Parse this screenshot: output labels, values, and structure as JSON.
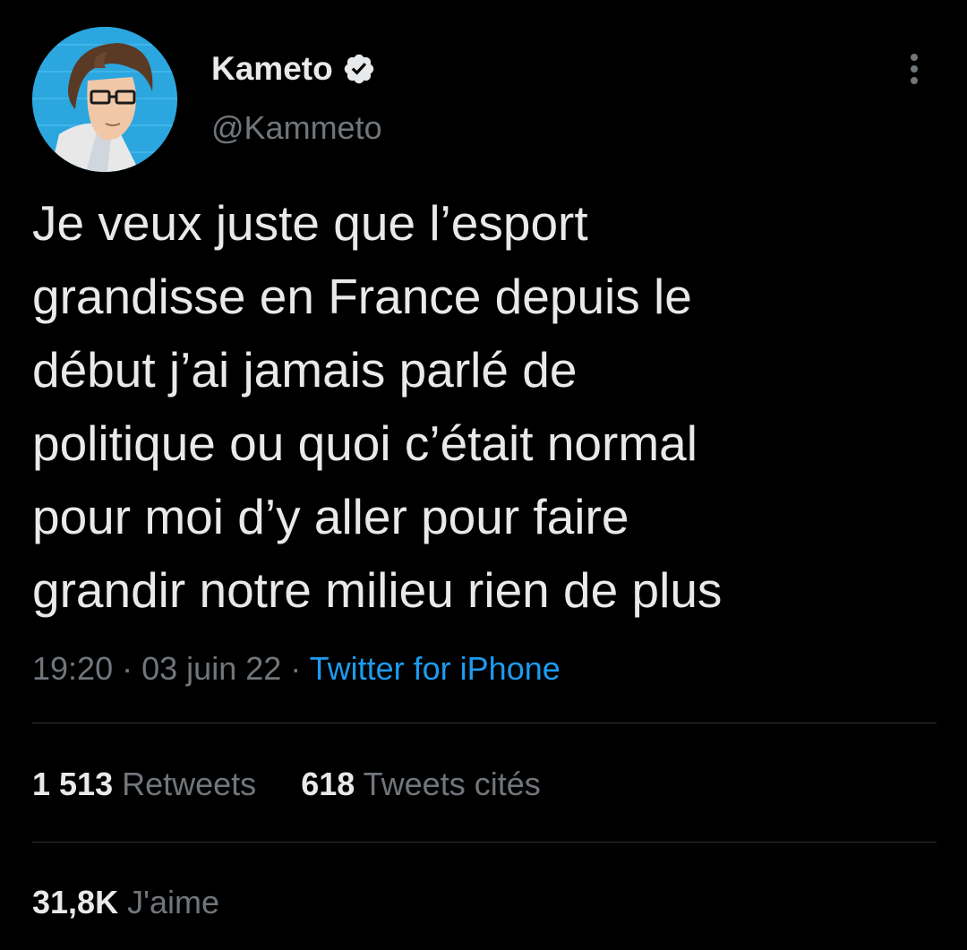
{
  "author": {
    "display_name": "Kameto",
    "handle": "@Kammeto",
    "verified": true,
    "avatar_icon": "profile-avatar"
  },
  "tweet": {
    "text_lines": [
      "Je veux juste que l’esport",
      "grandisse en France depuis le",
      "début j’ai jamais parlé de",
      "politique ou quoi c’était normal",
      "pour moi d’y aller pour faire",
      "grandir notre milieu rien de plus"
    ],
    "time": "19:20",
    "date": "03 juin 22",
    "separator": "·",
    "source": "Twitter for iPhone"
  },
  "stats": {
    "retweets_count": "1 513",
    "retweets_label": "Retweets",
    "quotes_count": "618",
    "quotes_label": "Tweets cités",
    "likes_count": "31,8K",
    "likes_label": "J'aime"
  },
  "colors": {
    "background": "#000000",
    "text_primary": "#e7e9ea",
    "text_secondary": "#71767b",
    "accent": "#1d9bf0",
    "divider": "#2f3336"
  }
}
